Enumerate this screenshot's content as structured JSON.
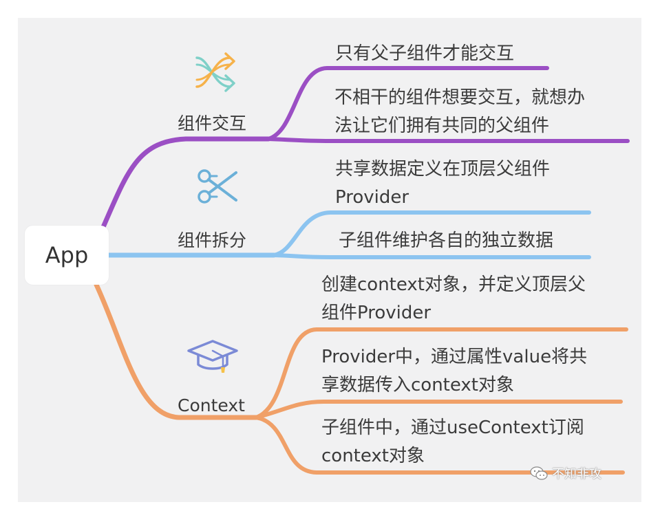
{
  "root": {
    "label": "App"
  },
  "branches": [
    {
      "label": "组件交互",
      "icon": "shuffle-arrows-icon",
      "color": "#9b4fc4",
      "leaves": [
        {
          "lines": [
            "只有父子组件才能交互"
          ]
        },
        {
          "lines": [
            "不相干的组件想要交互，就想办",
            "法让它们拥有共同的父组件"
          ]
        }
      ]
    },
    {
      "label": "组件拆分",
      "icon": "scissors-icon",
      "color": "#8cc4f0",
      "leaves": [
        {
          "lines": [
            "共享数据定义在顶层父组件",
            "Provider"
          ]
        },
        {
          "lines": [
            "子组件维护各自的独立数据"
          ]
        }
      ]
    },
    {
      "label": "Context",
      "icon": "graduation-cap-icon",
      "color": "#f0a068",
      "leaves": [
        {
          "lines": [
            "创建context对象，并定义顶层父",
            "组件Provider"
          ]
        },
        {
          "lines": [
            "Provider中，通过属性value将共",
            "享数据传入context对象"
          ]
        },
        {
          "lines": [
            "子组件中，通过useContext订阅",
            "context对象"
          ]
        }
      ]
    }
  ],
  "watermark": {
    "text": "不知非攻",
    "icon": "wechat-icon"
  }
}
